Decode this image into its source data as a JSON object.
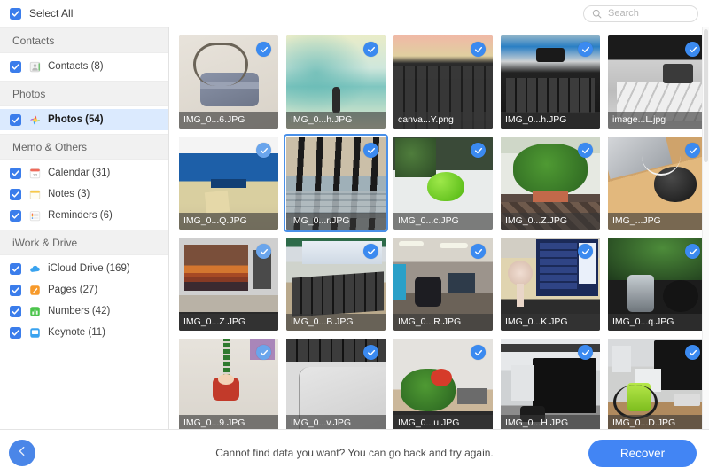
{
  "topbar": {
    "select_all_label": "Select All",
    "select_all_checked": true,
    "search": {
      "placeholder": "Search",
      "value": "",
      "icon": "search-icon"
    }
  },
  "sidebar": {
    "groups": [
      {
        "header": "Contacts",
        "items": [
          {
            "label": "Contacts (8)",
            "checked": true,
            "selected": false,
            "icon": "contacts-icon"
          }
        ]
      },
      {
        "header": "Photos",
        "items": [
          {
            "label": "Photos (54)",
            "checked": true,
            "selected": true,
            "icon": "photos-icon"
          }
        ]
      },
      {
        "header": "Memo & Others",
        "items": [
          {
            "label": "Calendar (31)",
            "checked": true,
            "selected": false,
            "icon": "calendar-icon"
          },
          {
            "label": "Notes (3)",
            "checked": true,
            "selected": false,
            "icon": "notes-icon"
          },
          {
            "label": "Reminders (6)",
            "checked": true,
            "selected": false,
            "icon": "reminders-icon"
          }
        ]
      },
      {
        "header": "iWork & Drive",
        "items": [
          {
            "label": "iCloud Drive (169)",
            "checked": true,
            "selected": false,
            "icon": "icloud-drive-icon"
          },
          {
            "label": "Pages (27)",
            "checked": true,
            "selected": false,
            "icon": "pages-icon"
          },
          {
            "label": "Numbers (42)",
            "checked": true,
            "selected": false,
            "icon": "numbers-icon"
          },
          {
            "label": "Keynote (11)",
            "checked": true,
            "selected": false,
            "icon": "keynote-icon"
          }
        ]
      }
    ]
  },
  "grid": {
    "items": [
      {
        "name": "IMG_0...6.JPG",
        "checked": true,
        "selected": false,
        "art": "bag"
      },
      {
        "name": "IMG_0...h.JPG",
        "checked": true,
        "selected": false,
        "art": "painting"
      },
      {
        "name": "canva...Y.png",
        "checked": true,
        "selected": false,
        "art": "keyboard-dark"
      },
      {
        "name": "IMG_0...h.JPG",
        "checked": true,
        "selected": false,
        "art": "monitor-keyboard"
      },
      {
        "name": "image...L.jpg",
        "checked": true,
        "selected": false,
        "art": "mac-keyboard"
      },
      {
        "name": "IMG_0...Q.JPG",
        "checked": true,
        "selected": false,
        "art": "blue-monitor"
      },
      {
        "name": "IMG_0...r.JPG",
        "checked": true,
        "selected": true,
        "art": "window-bars"
      },
      {
        "name": "IMG_0...c.JPG",
        "checked": true,
        "selected": false,
        "art": "green-pot"
      },
      {
        "name": "IMG_0...Z.JPG",
        "checked": true,
        "selected": false,
        "art": "plant-pot"
      },
      {
        "name": "IMG_...JPG",
        "checked": true,
        "selected": false,
        "art": "laptop-mouse"
      },
      {
        "name": "IMG_0...Z.JPG",
        "checked": true,
        "selected": false,
        "art": "imac-desert"
      },
      {
        "name": "IMG_0...B.JPG",
        "checked": true,
        "selected": false,
        "art": "desk-keyboard"
      },
      {
        "name": "IMG_0...R.JPG",
        "checked": true,
        "selected": false,
        "art": "office"
      },
      {
        "name": "IMG_0...K.JPG",
        "checked": true,
        "selected": false,
        "art": "fan-monitor"
      },
      {
        "name": "IMG_0...q.JPG",
        "checked": true,
        "selected": false,
        "art": "kettle-plant"
      },
      {
        "name": "IMG_0...9.JPG",
        "checked": true,
        "selected": false,
        "art": "santa"
      },
      {
        "name": "IMG_0...v.JPG",
        "checked": true,
        "selected": false,
        "art": "macbook"
      },
      {
        "name": "IMG_0...u.JPG",
        "checked": true,
        "selected": false,
        "art": "red-flower"
      },
      {
        "name": "IMG_0...H.JPG",
        "checked": true,
        "selected": false,
        "art": "dark-imac"
      },
      {
        "name": "IMG_0...D.JPG",
        "checked": true,
        "selected": false,
        "art": "desk-imacs"
      }
    ]
  },
  "footer": {
    "back_icon": "arrow-left-icon",
    "message": "Cannot find data you want? You can go back and try again.",
    "recover_label": "Recover"
  },
  "colors": {
    "accent": "#4285f4",
    "checkbox": "#3B7DEB",
    "selected_row": "#dbeafe",
    "selection_border": "#4a90e8"
  }
}
